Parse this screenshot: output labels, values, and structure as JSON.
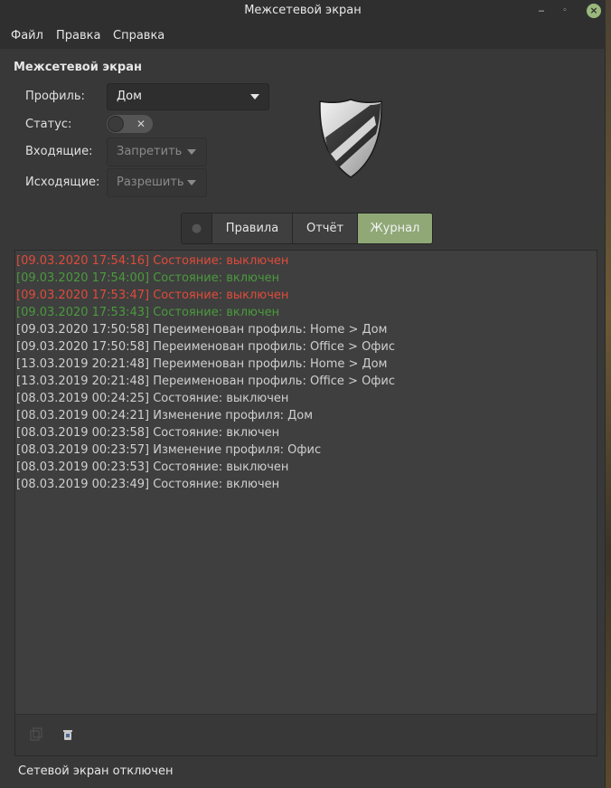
{
  "window": {
    "title": "Межсетевой экран"
  },
  "menu": [
    "Файл",
    "Правка",
    "Справка"
  ],
  "section_title": "Межсетевой экран",
  "form": {
    "profile_label": "Профиль:",
    "profile_value": "Дом",
    "status_label": "Статус:",
    "status_on": false,
    "incoming_label": "Входящие:",
    "incoming_value": "Запретить",
    "outgoing_label": "Исходящие:",
    "outgoing_value": "Разрешить"
  },
  "tabs": {
    "rules": "Правила",
    "report": "Отчёт",
    "journal": "Журнал",
    "active": "journal"
  },
  "log": [
    {
      "text": "[09.03.2020 17:54:16] Состояние: выключен",
      "color": "red"
    },
    {
      "text": "[09.03.2020 17:54:00] Состояние: включен",
      "color": "green"
    },
    {
      "text": "[09.03.2020 17:53:47] Состояние: выключен",
      "color": "red"
    },
    {
      "text": "[09.03.2020 17:53:43] Состояние: включен",
      "color": "green"
    },
    {
      "text": "[09.03.2020 17:50:58] Переименован профиль: Home > Дом",
      "color": "default"
    },
    {
      "text": "[09.03.2020 17:50:58] Переименован профиль: Office > Офис",
      "color": "default"
    },
    {
      "text": "[13.03.2019 20:21:48] Переименован профиль: Home > Дом",
      "color": "default"
    },
    {
      "text": "[13.03.2019 20:21:48] Переименован профиль: Office > Офис",
      "color": "default"
    },
    {
      "text": "[08.03.2019 00:24:25] Состояние: выключен",
      "color": "default"
    },
    {
      "text": "[08.03.2019 00:24:21] Изменение профиля: Дом",
      "color": "default"
    },
    {
      "text": "[08.03.2019 00:23:58] Состояние: включен",
      "color": "default"
    },
    {
      "text": "[08.03.2019 00:23:57] Изменение профиля: Офис",
      "color": "default"
    },
    {
      "text": "[08.03.2019 00:23:53] Состояние: выключен",
      "color": "default"
    },
    {
      "text": "[08.03.2019 00:23:49] Состояние: включен",
      "color": "default"
    }
  ],
  "status_bar": "Сетевой экран отключен",
  "colors": {
    "accent": "#8fa876",
    "log_off": "#e04b3a",
    "log_on": "#4a9a3c"
  },
  "icons": {
    "tab_home": "home-icon",
    "copy": "copy-icon",
    "clear": "trash-icon",
    "logo": "shield-icon"
  }
}
